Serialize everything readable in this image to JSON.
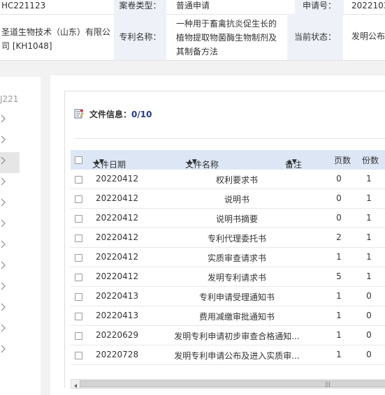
{
  "info": {
    "case_id": "HC221123",
    "case_type_label": "案卷类型：",
    "case_type": "普通申请",
    "app_no_label": "申请号：",
    "app_no": "2022103",
    "company": "圣道生物技术（山东）有限公司 [KH1048]",
    "patent_name_label": "专利名称：",
    "patent_name": "一种用于畜禽抗炎促生长的植物提取物菌酶生物制剂及其制备方法",
    "status_label": "当前状态：",
    "status": "发明公布"
  },
  "sidebar": {
    "id_text": "J221",
    "item_count": 12
  },
  "file_info": {
    "label": "文件信息：",
    "count": "0/10"
  },
  "grid": {
    "columns": {
      "date": "文件日期",
      "name": "文件名称",
      "note": "备注",
      "pages": "页数",
      "copies": "份数"
    },
    "rows": [
      {
        "date": "20220412",
        "name": "权利要求书",
        "pages": "0",
        "copies": "1"
      },
      {
        "date": "20220412",
        "name": "说明书",
        "pages": "0",
        "copies": "1"
      },
      {
        "date": "20220412",
        "name": "说明书摘要",
        "pages": "0",
        "copies": "1"
      },
      {
        "date": "20220412",
        "name": "专利代理委托书",
        "pages": "2",
        "copies": "1"
      },
      {
        "date": "20220412",
        "name": "实质审查请求书",
        "pages": "1",
        "copies": "1"
      },
      {
        "date": "20220412",
        "name": "发明专利请求书",
        "pages": "5",
        "copies": "1"
      },
      {
        "date": "20220413",
        "name": "专利申请受理通知书",
        "pages": "1",
        "copies": "0"
      },
      {
        "date": "20220413",
        "name": "费用减缴审批通知书",
        "pages": "1",
        "copies": "0"
      },
      {
        "date": "20220629",
        "name": "发明专利申请初步审查合格通知...",
        "pages": "1",
        "copies": "0"
      },
      {
        "date": "20220728",
        "name": "发明专利申请公布及进入实质审...",
        "pages": "1",
        "copies": "0"
      }
    ]
  },
  "icons": {
    "chevron": "chevron-right-icon",
    "file_info": "edit-list-icon",
    "sort": "sort-arrows-icon",
    "scroll_left": "arrow-left-icon"
  }
}
